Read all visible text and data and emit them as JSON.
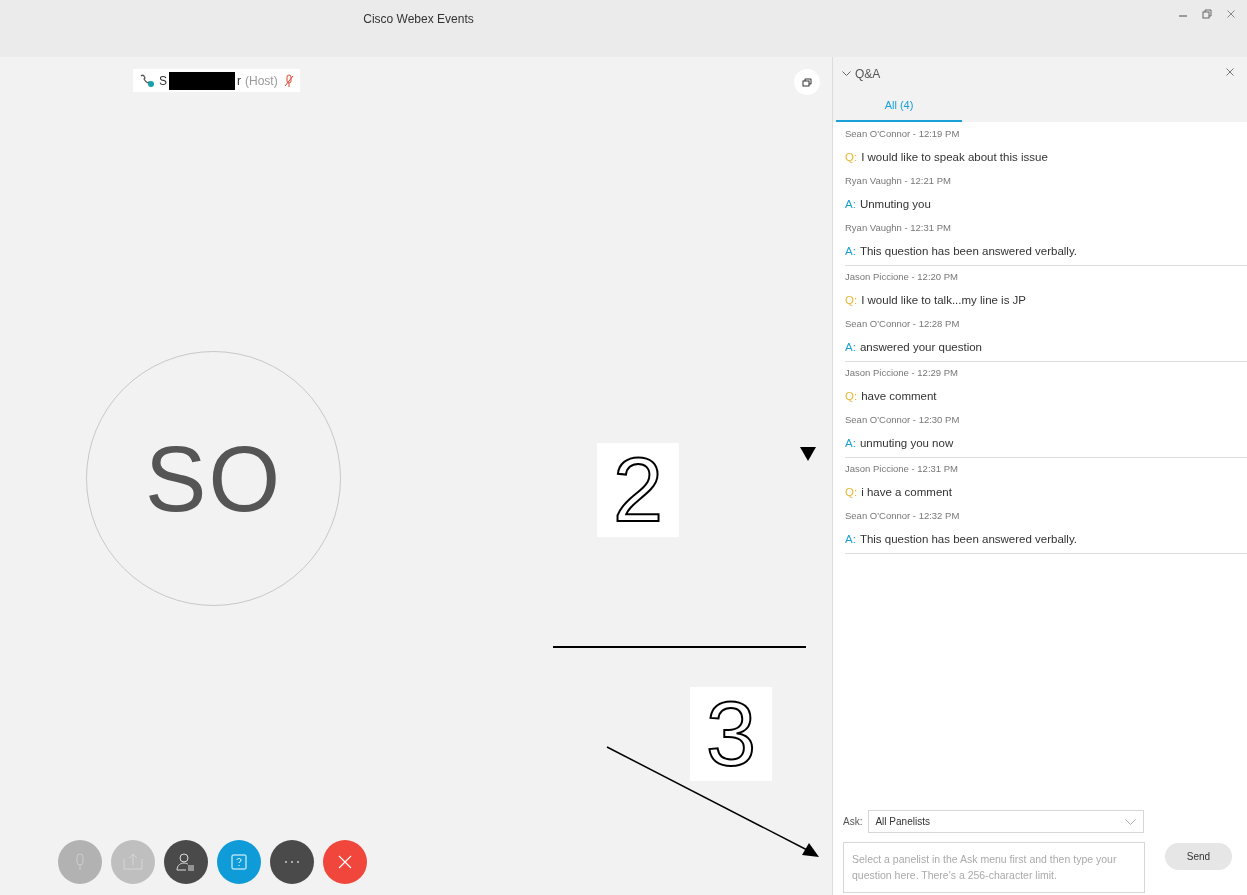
{
  "window": {
    "title": "Cisco Webex Events"
  },
  "participant": {
    "name_start": "S",
    "redacted": true,
    "name_end": "r",
    "role": "(Host)",
    "muted": true
  },
  "avatar": {
    "initials": "SO"
  },
  "annotations": [
    {
      "kind": "number",
      "text": "2"
    },
    {
      "kind": "triangle"
    },
    {
      "kind": "line"
    },
    {
      "kind": "number",
      "text": "3"
    },
    {
      "kind": "arrow"
    }
  ],
  "controls": [
    {
      "kind": "mute",
      "disabled": true
    },
    {
      "kind": "share",
      "disabled": true
    },
    {
      "kind": "participants",
      "disabled": false
    },
    {
      "kind": "qa",
      "disabled": false
    },
    {
      "kind": "more",
      "disabled": false
    },
    {
      "kind": "leave",
      "disabled": false
    }
  ],
  "qa_panel": {
    "title": "Q&A",
    "tabs": [
      {
        "label": "All (4)",
        "selected": true
      }
    ],
    "threads": [
      {
        "entries": [
          {
            "author": "Sean O'Connor - 12:19 PM",
            "kind": "question",
            "prefix": "Q:",
            "text": "I would like to speak about this issue"
          },
          {
            "author": "Ryan Vaughn - 12:21 PM",
            "kind": "answer",
            "prefix": "A:",
            "text": "Unmuting you"
          },
          {
            "author": "Ryan Vaughn - 12:31 PM",
            "kind": "answer",
            "prefix": "A:",
            "text": "This question has been answered verbally."
          }
        ]
      },
      {
        "entries": [
          {
            "author": "Jason Piccione - 12:20 PM",
            "kind": "question",
            "prefix": "Q:",
            "text": "I would like to talk...my line is JP"
          },
          {
            "author": "Sean O'Connor - 12:28 PM",
            "kind": "answer",
            "prefix": "A:",
            "text": "answered your question"
          }
        ]
      },
      {
        "entries": [
          {
            "author": "Jason Piccione - 12:29 PM",
            "kind": "question",
            "prefix": "Q:",
            "text": "have comment"
          },
          {
            "author": "Sean O'Connor - 12:30 PM",
            "kind": "answer",
            "prefix": "A:",
            "text": "unmuting you now"
          }
        ]
      },
      {
        "entries": [
          {
            "author": "Jason Piccione - 12:31 PM",
            "kind": "question",
            "prefix": "Q:",
            "text": "i have a comment"
          },
          {
            "author": "Sean O'Connor - 12:32 PM",
            "kind": "answer",
            "prefix": "A:",
            "text": "This question has been answered verbally."
          }
        ]
      }
    ],
    "ask_label": "Ask:",
    "ask_value": "All Panelists",
    "placeholder": "Select a panelist in the Ask menu first and then type your question here. There's a 256-character limit.",
    "send_label": "Send"
  }
}
